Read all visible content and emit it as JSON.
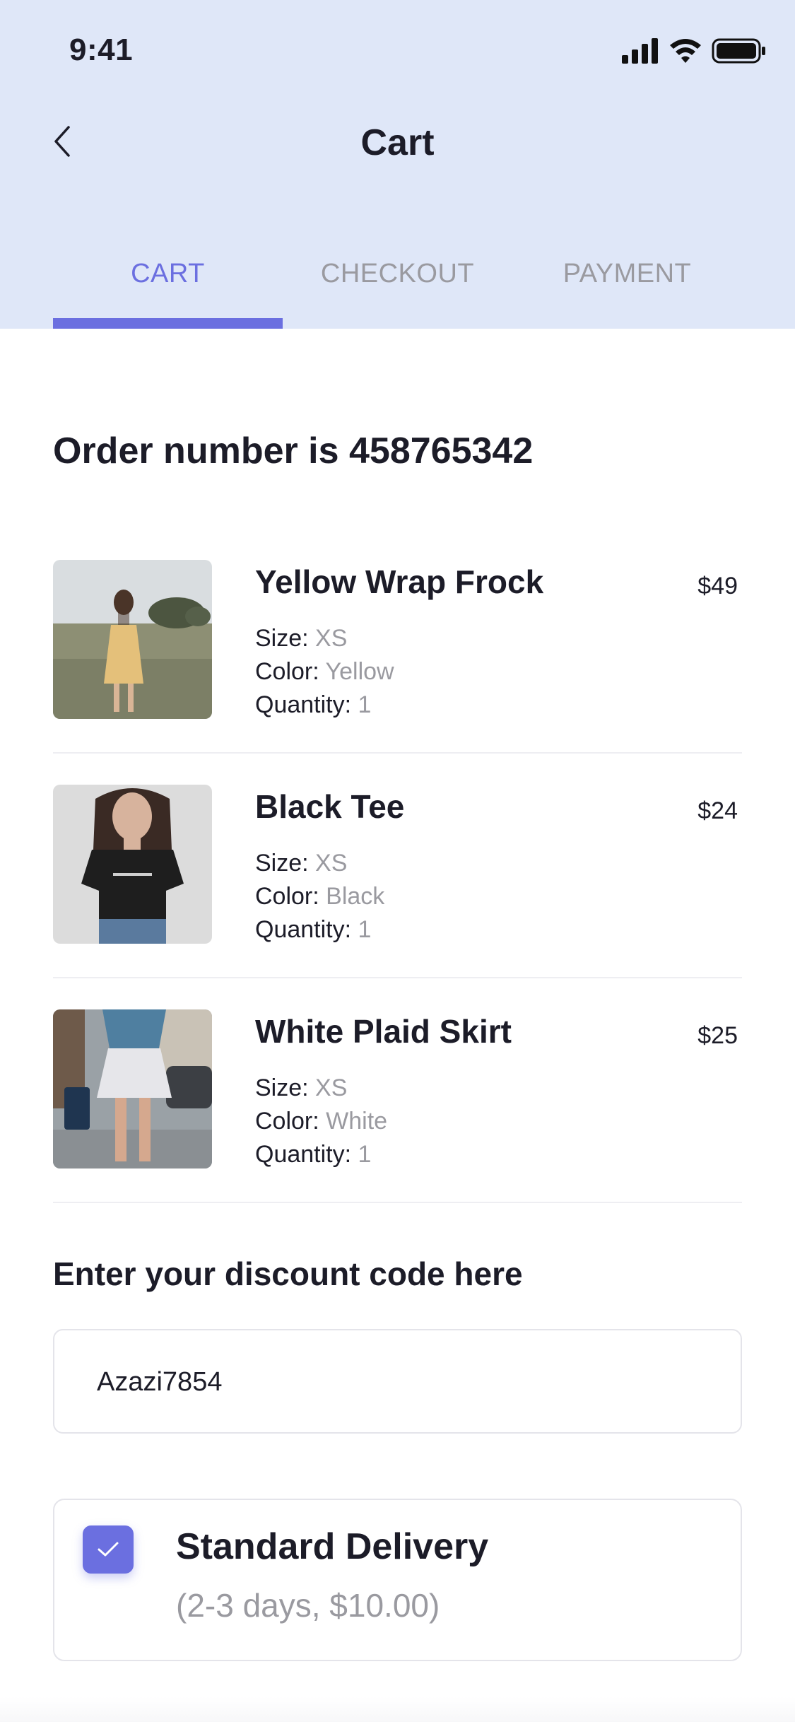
{
  "status_bar": {
    "time": "9:41"
  },
  "header": {
    "title": "Cart"
  },
  "tabs": [
    {
      "label": "CART",
      "active": true
    },
    {
      "label": "CHECKOUT",
      "active": false
    },
    {
      "label": "PAYMENT",
      "active": false
    }
  ],
  "order": {
    "label": "Order number is 458765342"
  },
  "items": [
    {
      "name": "Yellow Wrap Frock",
      "price": "$49",
      "size_label": "Size:",
      "size": "XS",
      "color_label": "Color:",
      "color": "Yellow",
      "quantity_label": "Quantity:",
      "quantity": "1"
    },
    {
      "name": "Black Tee",
      "price": "$24",
      "size_label": "Size:",
      "size": "XS",
      "color_label": "Color:",
      "color": "Black",
      "quantity_label": "Quantity:",
      "quantity": "1"
    },
    {
      "name": "White Plaid Skirt",
      "price": "$25",
      "size_label": "Size:",
      "size": "XS",
      "color_label": "Color:",
      "color": "White",
      "quantity_label": "Quantity:",
      "quantity": "1"
    }
  ],
  "discount": {
    "label": "Enter your discount code here",
    "value": "Azazi7854"
  },
  "delivery": {
    "title": "Standard Delivery",
    "subtitle": "(2-3 days, $10.00)",
    "checked": true
  },
  "colors": {
    "accent": "#6b6fe0",
    "header_bg": "#dfe7f8",
    "muted_text": "#9a9aa0",
    "text": "#1c1c28"
  }
}
